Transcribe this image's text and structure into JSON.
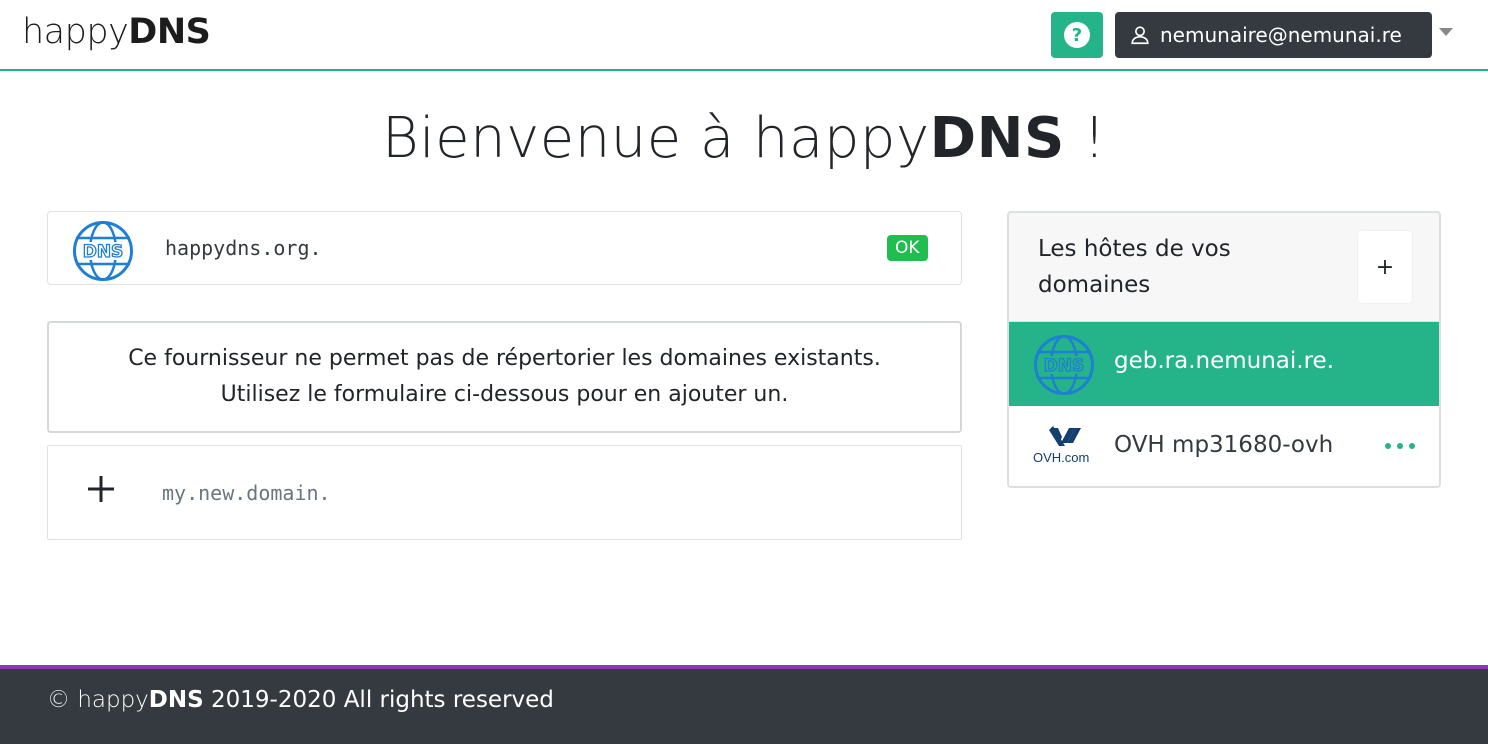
{
  "navbar": {
    "brand_light": "happy",
    "brand_bold": "DNS",
    "help_label": "?",
    "user_email": "nemunaire@nemunai.re",
    "accent_color": "#25b48a"
  },
  "main": {
    "title_prefix": "Bienvenue à happy",
    "title_bold": "DNS",
    "title_suffix": "!"
  },
  "domains": [
    {
      "name": "happydns.org.",
      "status": "OK",
      "icon": "dns-globe-icon"
    }
  ],
  "notice": {
    "line1": "Ce fournisseur ne permet pas de répertorier les domaines existants.",
    "line2": "Utilisez le formulaire ci-dessous pour en ajouter un."
  },
  "new_domain": {
    "placeholder": "my.new.domain.",
    "icon": "plus-icon"
  },
  "hosts": {
    "title": "Les hôtes de vos domaines",
    "add_label": "+",
    "items": [
      {
        "name": "geb.ra.nemunai.re.",
        "icon": "dns-globe-icon",
        "active": true
      },
      {
        "name": "OVH mp31680-ovh",
        "icon": "ovh-logo-icon",
        "logo_text": "OVH.com",
        "active": false
      }
    ]
  },
  "footer": {
    "copyright_symbol": "©",
    "brand_light": "happy",
    "brand_bold": "DNS",
    "text": "2019-2020 All rights reserved",
    "border_color": "#9332bb"
  }
}
